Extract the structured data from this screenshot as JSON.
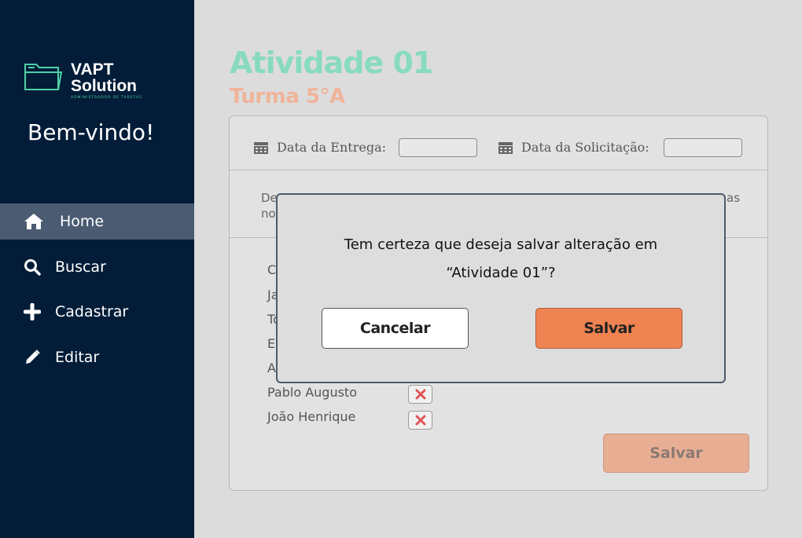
{
  "brand": {
    "title_line1": "VAPT",
    "title_line2": "Solution",
    "tagline": "ADMINISTRADOR DE TAREFAS"
  },
  "sidebar": {
    "welcome": "Bem-vindo!",
    "items": [
      {
        "label": "Home",
        "icon": "home-icon",
        "active": true
      },
      {
        "label": "Buscar",
        "icon": "search-icon",
        "active": false
      },
      {
        "label": "Cadastrar",
        "icon": "plus-icon",
        "active": false
      },
      {
        "label": "Editar",
        "icon": "pencil-icon",
        "active": false
      }
    ]
  },
  "main": {
    "title": "Atividade 01",
    "subtitle": "Turma 5°A",
    "delivery_label": "Data da Entrega:",
    "delivery_value": "",
    "request_label": "Data da Solicitação:",
    "request_value": "",
    "description_start": "De",
    "description_start2": "no",
    "description_end": "as",
    "students": [
      {
        "name": "Cl",
        "status": ""
      },
      {
        "name": "Ja",
        "status": ""
      },
      {
        "name": "To",
        "status": ""
      },
      {
        "name": "Eu",
        "status": ""
      },
      {
        "name": "A",
        "status": ""
      },
      {
        "name": "Pablo Augusto",
        "status": "x"
      },
      {
        "name": "João Henrique",
        "status": "x"
      }
    ],
    "save_label": "Salvar"
  },
  "modal": {
    "line1": "Tem certeza que deseja salvar alteração em",
    "line2": "“Atividade 01”?",
    "cancel_label": "Cancelar",
    "confirm_label": "Salvar"
  },
  "colors": {
    "sidebar_bg": "#031d38",
    "active_nav": "#4a5b72",
    "title": "#88dbbd",
    "subtitle": "#f0b49a",
    "accent": "#f08352",
    "remove_x": "#e05555"
  }
}
